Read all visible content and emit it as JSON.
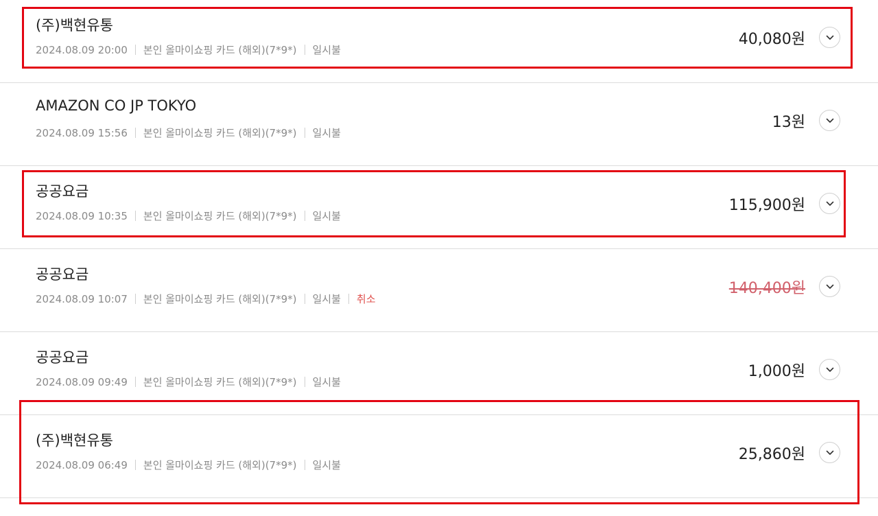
{
  "transactions": [
    {
      "merchant": "(주)백현유통",
      "datetime": "2024.08.09 20:00",
      "card": "본인 올마이쇼핑 카드 (해외)(7*9*)",
      "installment": "일시불",
      "status": "",
      "amount": "40,080원",
      "expand_icon": "chevron-down-icon"
    },
    {
      "merchant": "AMAZON CO JP TOKYO",
      "datetime": "2024.08.09 15:56",
      "card": "본인 올마이쇼핑 카드 (해외)(7*9*)",
      "installment": "일시불",
      "status": "",
      "amount": "13원",
      "expand_icon": "chevron-down-icon"
    },
    {
      "merchant": "공공요금",
      "datetime": "2024.08.09 10:35",
      "card": "본인 올마이쇼핑 카드 (해외)(7*9*)",
      "installment": "일시불",
      "status": "",
      "amount": "115,900원",
      "expand_icon": "chevron-down-icon"
    },
    {
      "merchant": "공공요금",
      "datetime": "2024.08.09 10:07",
      "card": "본인 올마이쇼핑 카드 (해외)(7*9*)",
      "installment": "일시불",
      "status": "취소",
      "amount": "140,400원",
      "expand_icon": "chevron-down-icon"
    },
    {
      "merchant": "공공요금",
      "datetime": "2024.08.09 09:49",
      "card": "본인 올마이쇼핑 카드 (해외)(7*9*)",
      "installment": "일시불",
      "status": "",
      "amount": "1,000원",
      "expand_icon": "chevron-down-icon"
    },
    {
      "merchant": "(주)백현유통",
      "datetime": "2024.08.09 06:49",
      "card": "본인 올마이쇼핑 카드 (해외)(7*9*)",
      "installment": "일시불",
      "status": "",
      "amount": "25,860원",
      "expand_icon": "chevron-down-icon"
    }
  ],
  "colors": {
    "highlight": "#e30613",
    "canceled_amount": "#d1606b",
    "cancel_status": "#e0524f",
    "meta_text": "#8a8a8a",
    "primary_text": "#222222"
  }
}
